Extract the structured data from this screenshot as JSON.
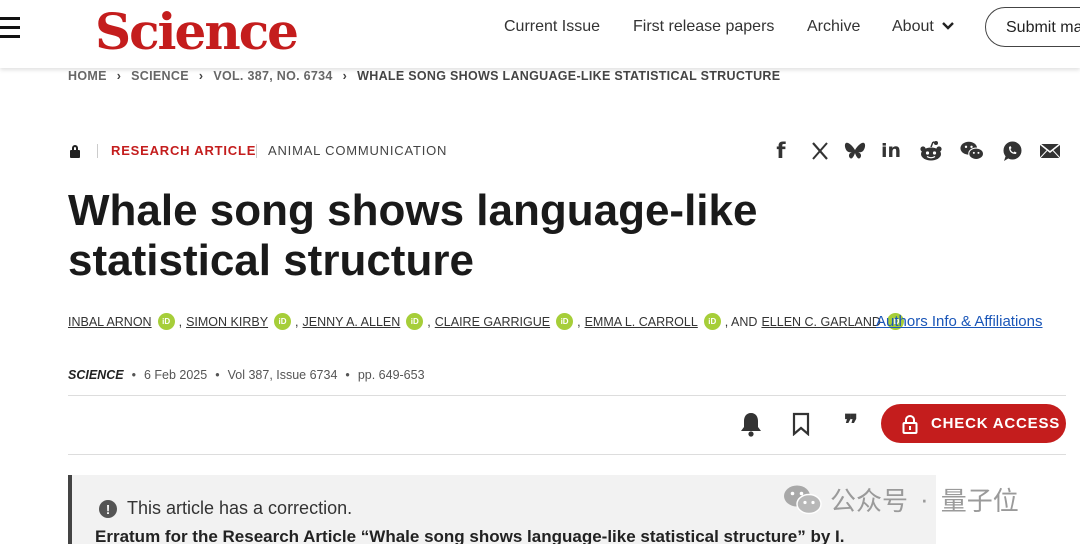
{
  "header": {
    "logo": "Science",
    "nav": [
      "Current Issue",
      "First release papers",
      "Archive",
      "About"
    ],
    "submit_label": "Submit ma"
  },
  "breadcrumb": [
    "HOME",
    "SCIENCE",
    "VOL. 387, NO. 6734",
    "WHALE SONG SHOWS LANGUAGE-LIKE STATISTICAL STRUCTURE"
  ],
  "article": {
    "type": "RESEARCH ARTICLE",
    "subject": "ANIMAL COMMUNICATION",
    "title": "Whale song shows language-like statistical structure",
    "authors": [
      "INBAL ARNON",
      "SIMON KIRBY",
      "JENNY A. ALLEN",
      "CLAIRE GARRIGUE",
      "EMMA L. CARROLL",
      "ELLEN C. GARLAND"
    ],
    "author_separators": [
      ",",
      ",",
      ",",
      ",",
      ", AND"
    ],
    "orcid_label": "iD",
    "affiliations_link": "Authors Info & Affiliations",
    "journal": "SCIENCE",
    "date": "6 Feb 2025",
    "volume": "Vol 387, Issue 6734",
    "pages": "pp. 649-653",
    "dot": "•"
  },
  "share_icons": [
    "facebook-icon",
    "x-twitter-icon",
    "bluesky-icon",
    "linkedin-icon",
    "reddit-icon",
    "wechat-icon",
    "whatsapp-icon",
    "email-icon"
  ],
  "share_glyphs": {
    "facebook": "f",
    "linkedin": "in"
  },
  "toolbar": {
    "quote_glyph": "❞",
    "check_access_label": "CHECK ACCESS"
  },
  "correction": {
    "icon_glyph": "!",
    "notice": "This article has a correction.",
    "link": "Erratum for the Research Article “Whale song shows language-like statistical structure” by I."
  },
  "watermark": {
    "channel": "公众号",
    "separator": "·",
    "name": "量子位"
  },
  "colors": {
    "brand_red": "#c41d1d",
    "orcid_green": "#a6ce39",
    "link_blue": "#1a56b8"
  }
}
